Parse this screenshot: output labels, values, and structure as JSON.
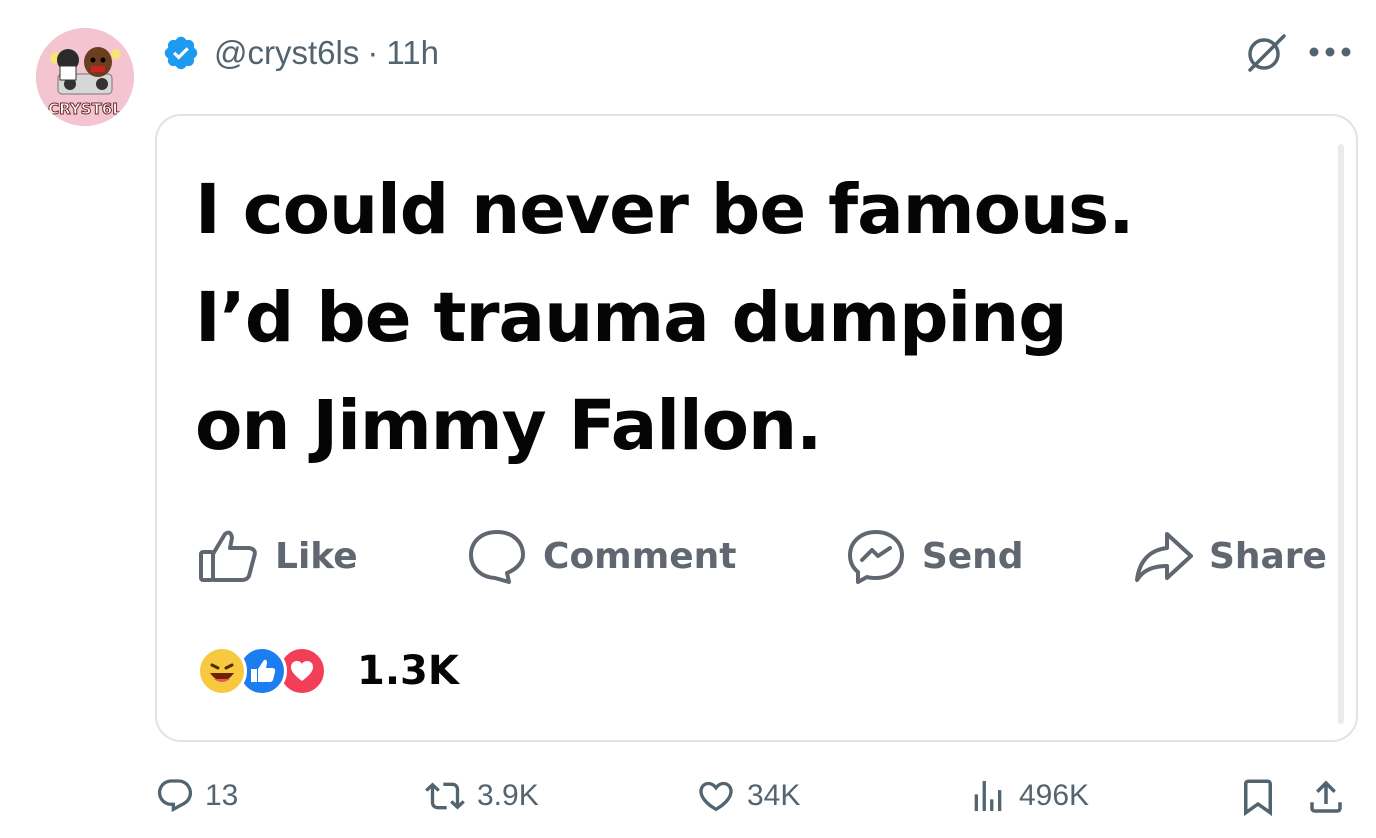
{
  "tweet": {
    "handle": "@cryst6ls",
    "separator": "·",
    "time": "11h",
    "avatar_label": "CRYST6L"
  },
  "card": {
    "lines": [
      "I could never be famous.",
      "I’d be trauma dumping",
      "on Jimmy Fallon."
    ],
    "actions": {
      "like": "Like",
      "comment": "Comment",
      "send": "Send",
      "share": "Share"
    },
    "reaction_count": "1.3K"
  },
  "footer": {
    "replies": "13",
    "reposts": "3.9K",
    "likes": "34K",
    "views": "496K"
  },
  "colors": {
    "verified": "#1d9bf0",
    "muted": "#536471",
    "fb_gray": "#606770"
  }
}
